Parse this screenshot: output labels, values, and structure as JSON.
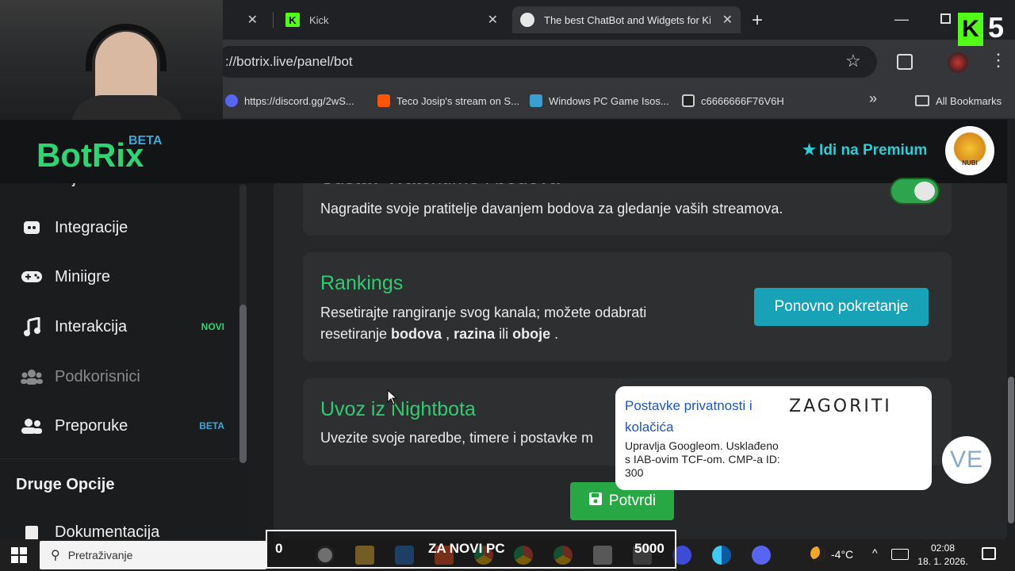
{
  "browser": {
    "tabs": [
      {
        "label": ""
      },
      {
        "label": "Kick"
      },
      {
        "label": "The best ChatBot and Widgets for Kic"
      }
    ],
    "new_tab_symbol": "+",
    "url": "://botrix.live/panel/bot",
    "bookmarks": [
      {
        "label": "https://discord.gg/2wS...",
        "icon": "discord-icon",
        "color": "#5865f2"
      },
      {
        "label": "Teco Josip's stream on S...",
        "icon": "soundcloud-icon",
        "color": "#ff5500"
      },
      {
        "label": "Windows PC Game Isos...",
        "icon": "game-iso-icon",
        "color": "#3aa0d0"
      },
      {
        "label": "c6666666F76V6H",
        "icon": "monitor-icon",
        "color": "#cccccc"
      }
    ],
    "all_bookmarks": "All Bookmarks"
  },
  "stream_overlay": {
    "kick_number": "5",
    "counter_left": "0",
    "banner_text": "ZA NOVI PC",
    "counter_right": "5000"
  },
  "header": {
    "logo": "BotRix",
    "logo_badge": "BETA",
    "premium_label": "Idi na Premium",
    "avatar_text": "NUBI"
  },
  "sidebar": {
    "items": [
      {
        "label": "Lojalnost",
        "icon": "loyalty-icon"
      },
      {
        "label": "Integracije",
        "icon": "discord-icon"
      },
      {
        "label": "Miniigre",
        "icon": "gamepad-icon"
      },
      {
        "label": "Interakcija",
        "icon": "music-icon",
        "badge": "NOVI",
        "badge_color": "#2ed573"
      },
      {
        "label": "Podkorisnici",
        "icon": "users-icon",
        "dim": true
      },
      {
        "label": "Preporuke",
        "icon": "user-group-icon",
        "badge": "BETA",
        "badge_color": "#43a6d8"
      }
    ],
    "section_title": "Druge Opcije",
    "docs": {
      "label": "Dokumentacija",
      "icon": "document-icon"
    }
  },
  "main": {
    "watchtime": {
      "title": "Sustav Watchtime i bodova",
      "desc": "Nagradite svoje pratitelje davanjem bodova za gledanje vaših streamova.",
      "enabled": true
    },
    "rankings": {
      "title": "Rankings",
      "desc_1": "Resetirajte rangiranje svog kanala; možete odabrati",
      "desc_2a": "resetiranje ",
      "bold_1": "bodova",
      "sep_1": " , ",
      "bold_2": "razina",
      "sep_2": " ili ",
      "bold_3": "oboje",
      "end": " .",
      "button": "Ponovno pokretanje"
    },
    "nightbot": {
      "title": "Uvoz iz Nightbota",
      "desc": "Uvezite svoje naredbe, timere i postavke m"
    },
    "save_button": "Potvrdi"
  },
  "privacy_popup": {
    "title": "Postavke privatnosti i kolačića",
    "brand": "ZAGORITI",
    "text": "Upravlja Googleom. Usklađeno s IAB-ovim TCF-om. CMP-a ID: 300"
  },
  "ve_badge": "VE",
  "taskbar": {
    "search_placeholder": "Pretraživanje",
    "temperature": "-4°C",
    "time": "02:08",
    "date": "18. 1. 2026."
  }
}
